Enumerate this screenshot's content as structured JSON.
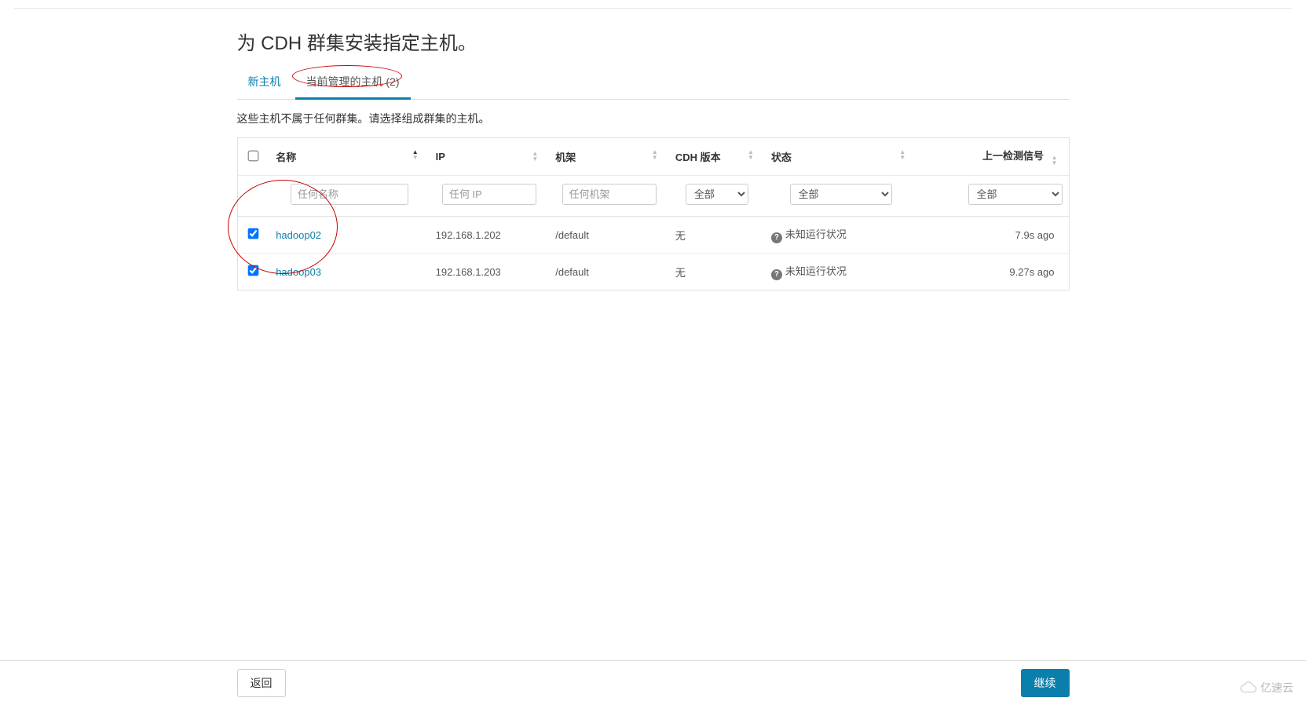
{
  "page": {
    "title": "为 CDH 群集安装指定主机。",
    "subtitle": "这些主机不属于任何群集。请选择组成群集的主机。"
  },
  "tabs": {
    "new_hosts": "新主机",
    "managed_hosts": "当前管理的主机 (2)"
  },
  "columns": {
    "name": "名称",
    "ip": "IP",
    "rack": "机架",
    "cdh_version": "CDH 版本",
    "status": "状态",
    "last_signal": "上一检测信号"
  },
  "filters": {
    "name_placeholder": "任何名称",
    "ip_placeholder": "任何 IP",
    "rack_placeholder": "任何机架",
    "cdh_option": "全部",
    "status_option": "全部",
    "signal_option": "全部"
  },
  "rows": [
    {
      "selected": true,
      "name": "hadoop02",
      "ip": "192.168.1.202",
      "rack": "/default",
      "cdh_version": "无",
      "status_text": "未知运行状况",
      "last_signal": "7.9s ago"
    },
    {
      "selected": true,
      "name": "hadoop03",
      "ip": "192.168.1.203",
      "rack": "/default",
      "cdh_version": "无",
      "status_text": "未知运行状况",
      "last_signal": "9.27s ago"
    }
  ],
  "footer": {
    "back": "返回",
    "continue": "继续"
  },
  "watermark": "亿速云",
  "annotations": {
    "tab_circle": true,
    "hosts_circle": true
  }
}
